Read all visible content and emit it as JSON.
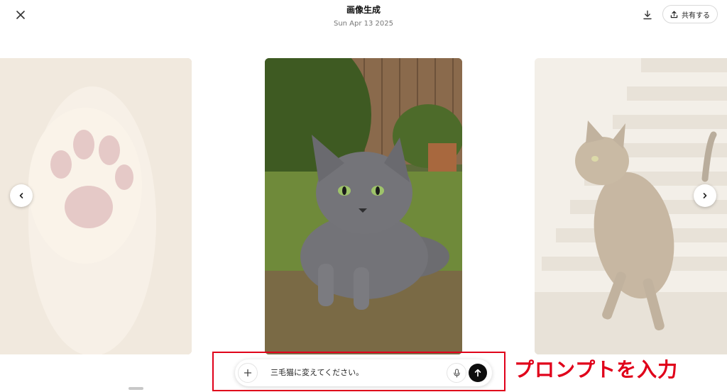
{
  "header": {
    "title": "画像生成",
    "date": "Sun Apr 13 2025",
    "share_label": "共有する",
    "close_icon": "close-icon",
    "download_icon": "download-icon",
    "share_icon": "upload-icon"
  },
  "gallery": {
    "images": [
      {
        "subject": "cat paw pads",
        "state": "faded"
      },
      {
        "subject": "gray cat lying on grass",
        "state": "selected"
      },
      {
        "subject": "tabby cat on stairs",
        "state": "faded"
      }
    ],
    "prev_icon": "chevron-left-icon",
    "next_icon": "chevron-right-icon"
  },
  "prompt": {
    "value": "三毛猫に変えてください。",
    "plus_icon": "plus-icon",
    "mic_icon": "microphone-icon",
    "send_icon": "arrow-up-icon"
  },
  "annotation": {
    "text": "プロンプトを入力",
    "color": "#e0001a"
  }
}
